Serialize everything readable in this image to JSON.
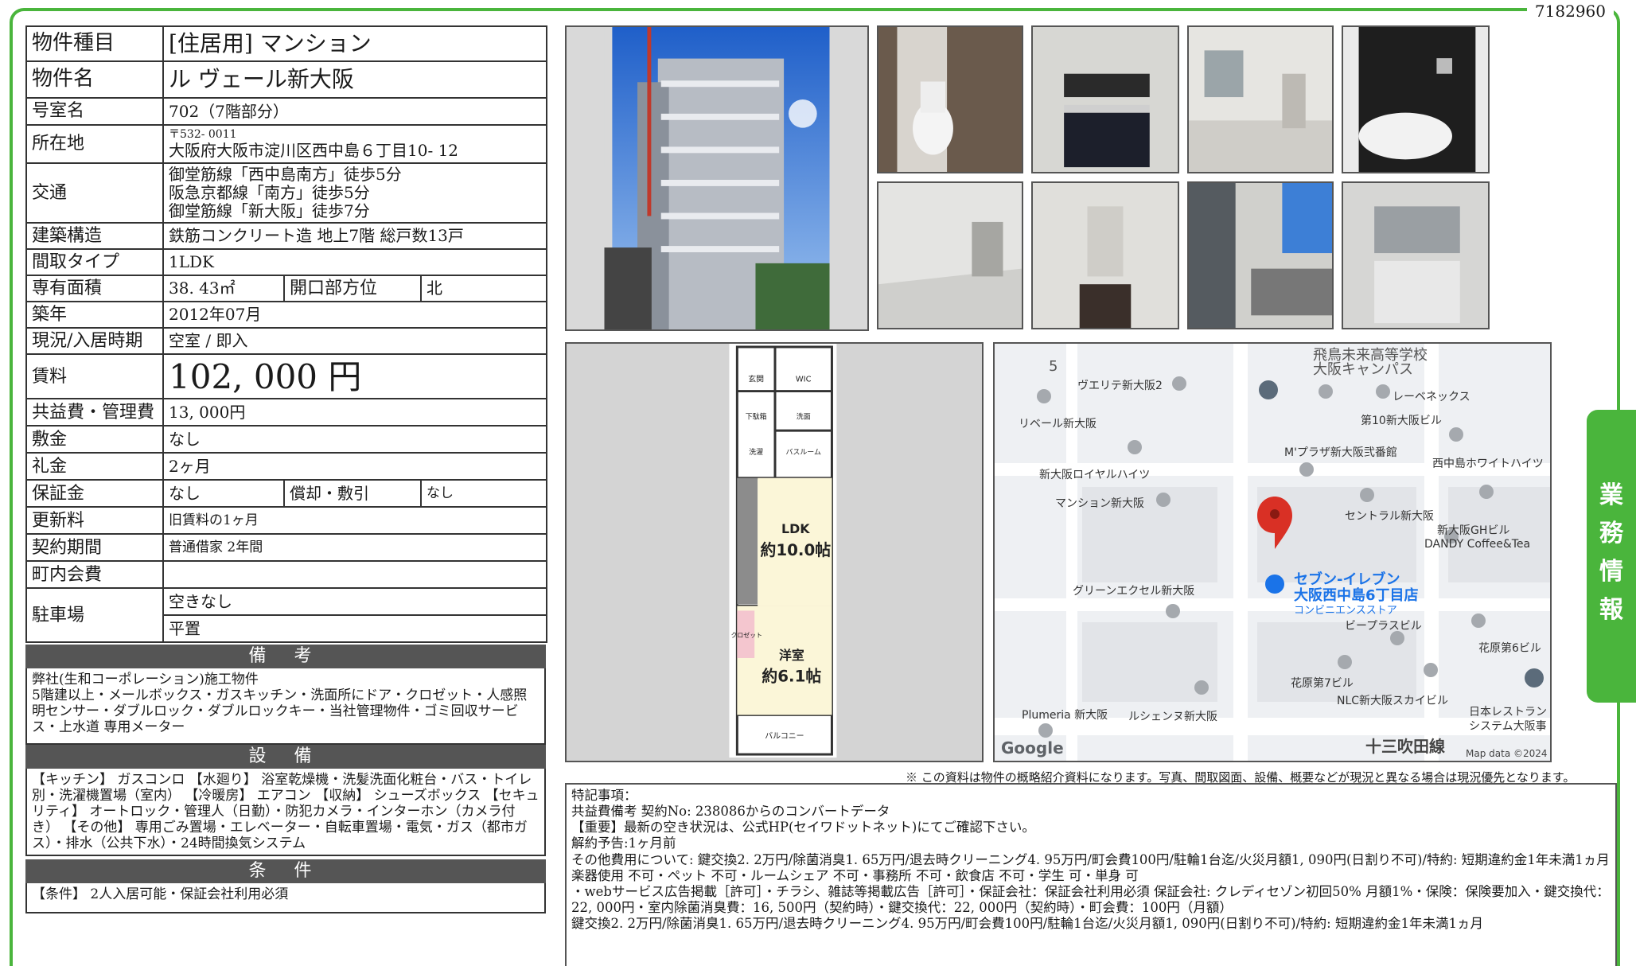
{
  "doc_id": "7182960",
  "spec": {
    "type_label": "物件種目",
    "type_value": "[住居用]  マンション",
    "name_label": "物件名",
    "name_value": "ル ヴェール新大阪",
    "room_label": "号室名",
    "room_value": "702（7階部分）",
    "address_label": "所在地",
    "postal": "〒532- 0011",
    "address_value": "大阪府大阪市淀川区西中島６丁目10- 12",
    "transit_label": "交通",
    "transit": [
      "御堂筋線「西中島南方」徒歩5分",
      "阪急京都線「南方」徒歩5分",
      "御堂筋線「新大阪」徒歩7分"
    ],
    "structure_label": "建築構造",
    "structure_value": "鉄筋コンクリート造  地上7階  総戸数13戸",
    "layout_label": "間取タイプ",
    "layout_value": "1LDK",
    "area_label": "専有面積",
    "area_value": "38. 43㎡",
    "facing_label": "開口部方位",
    "facing_value": "北",
    "built_label": "築年",
    "built_value": "2012年07月",
    "status_label": "現況/入居時期",
    "status_value": "空室  /  即入",
    "rent_label": "賃料",
    "rent_value": "102, 000  円",
    "fee_label": "共益費・管理費",
    "fee_value": "13, 000円",
    "deposit_label": "敷金",
    "deposit_value": "なし",
    "key_money_label": "礼金",
    "key_money_value": "2ヶ月",
    "guarantee_label": "保証金",
    "guarantee_value": "なし",
    "amort_label": "償却・敷引",
    "amort_value": "なし",
    "renewal_label": "更新料",
    "renewal_value": "旧賃料の1ヶ月",
    "contract_label": "契約期間",
    "contract_value": "普通借家  2年間",
    "town_label": "町内会費",
    "town_value": "",
    "parking_label": "駐車場",
    "parking_value1": "空きなし",
    "parking_value2": "平置"
  },
  "remarks": {
    "title": "備  考",
    "lines": [
      "弊社(生和コーポレーション)施工物件",
      "5階建以上・メールボックス・ガスキッチン・洗面所にドア・クロゼット・人感照明センサー・ダブルロック・ダブルロックキー・当社管理物件・ゴミ回収サービス・上水道 専用メーター"
    ]
  },
  "facilities": {
    "title": "設  備",
    "text": "【キッチン】 ガスコンロ 【水廻り】 浴室乾燥機・洗髪洗面化粧台・バス・トイレ別・洗濯機置場（室内） 【冷暖房】 エアコン 【収納】 シューズボックス 【セキュリティ】 オートロック・管理人（日勤）・防犯カメラ・インターホン（カメラ付き） 【その他】 専用ごみ置場・エレベーター・自転車置場・電気・ガス（都市ガス）・排水（公共下水）・24時間換気システム"
  },
  "conditions": {
    "title": "条  件",
    "text": "【条件】 2人入居可能・保証会社利用必須"
  },
  "floorplan": {
    "rooms": [
      "玄関",
      "WIC",
      "下駄箱",
      "洗面",
      "洗濯",
      "バスルーム",
      "LDK",
      "約10.0帖",
      "洋室",
      "約6.1帖",
      "クロゼット",
      "バルコニー"
    ]
  },
  "map": {
    "labels": {
      "block": "5",
      "school1": "飛鳥未来高等学校",
      "school2": "大阪キャンパス",
      "p1": "ヴエリテ新大阪2",
      "p2": "リベール新大阪",
      "p3": "レーベネックス",
      "p4": "第10新大阪ビル",
      "p5": "M'プラザ新大阪弐番館",
      "p6": "西中島ホワイトハイツ",
      "p7": "新大阪ロイヤルハイツ",
      "p8": "マンション新大阪",
      "p9": "セントラル新大阪",
      "p10": "新大阪GHビル",
      "p11": "DANDY Coffee&Tea",
      "store1": "セブン-イレブン",
      "store2": "大阪西中島6丁目店",
      "store3": "コンビニエンスストア",
      "p12": "グリーンエクセル新大阪",
      "p13": "ビープラスビル",
      "p14": "花原第6ビル",
      "p15": "花原第7ビル",
      "p16": "NLC新大阪スカイビル",
      "p17": "日本レストラン",
      "p18": "システム大阪事",
      "p19": "Plumeria 新大阪",
      "p20": "ルシェンヌ新大阪",
      "road": "十三吹田線",
      "google": "Google",
      "copyright": "Map data ©2024"
    }
  },
  "disclaimer": "※ この資料は物件の概略紹介資料になります。写真、間取図面、設備、概要などが現況と異なる場合は現況優先となります。",
  "notes": [
    "特記事項：",
    "共益費備考 契約No: 238086からのコンバートデータ",
    "【重要】最新の空き状況は、公式HP(セイワドットネット)にてご確認下さい。",
    "解約予告:1ヶ月前",
    "その他費用について: 鍵交換2. 2万円/除菌消臭1. 65万円/退去時クリーニング4. 95万円/町会費100円/駐輪1台迄/火災月額1, 090円(日割り不可)/特約: 短期違約金1年未満1ヵ月",
    "楽器使用 不可・ペット 不可・ルームシェア 不可・事務所 不可・飲食店 不可・学生 可・単身 可",
    "・webサービス広告掲載［許可］・チラシ、雑誌等掲載広告［許可］・保証会社：保証会社利用必須 保証会社: クレディセゾン初回50% 月額1%・保険：保険要加入・鍵交換代：22, 000円・室内除菌消臭費：16, 500円（契約時）・鍵交換代：22, 000円（契約時）・町会費：100円（月額）",
    "鍵交換2. 2万円/除菌消臭1. 65万円/退去時クリーニング4. 95万円/町会費100円/駐輪1台迄/火災月額1, 090円(日割り不可)/特約: 短期違約金1年未満1ヵ月"
  ],
  "side_tab": [
    "業",
    "務",
    "情",
    "報"
  ],
  "colors": {
    "accent": "#4ab53c",
    "section_bar": "#555555",
    "pin": "#d93025",
    "store": "#1a73e8"
  }
}
